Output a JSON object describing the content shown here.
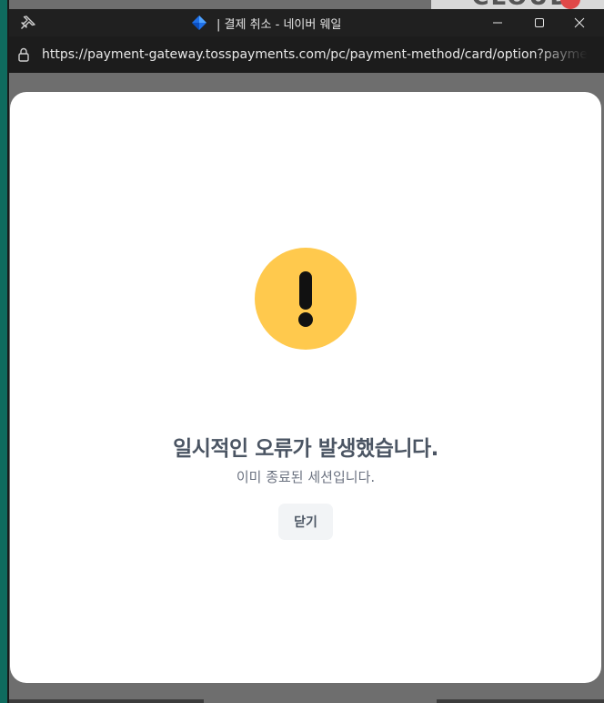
{
  "browser": {
    "window_title": "| 결제 취소 - 네이버 웨일",
    "url": "https://payment-gateway.tosspayments.com/pc/payment-method/card/option?paymentMethod=CARD",
    "icons": {
      "pin": "pin-icon",
      "app": "whale-browser-icon",
      "minimize": "minimize-icon",
      "maximize": "maximize-icon",
      "close": "close-icon",
      "lock": "lock-icon"
    }
  },
  "background": {
    "partial_text": "CLOUD"
  },
  "dialog": {
    "icon": "warning-icon",
    "title": "일시적인 오류가 발생했습니다.",
    "message": "이미 종료된 세션입니다.",
    "close_button_label": "닫기"
  },
  "colors": {
    "warning_circle": "#FFC94D",
    "title_text": "#4B5563",
    "button_bg": "#F2F4F6"
  }
}
